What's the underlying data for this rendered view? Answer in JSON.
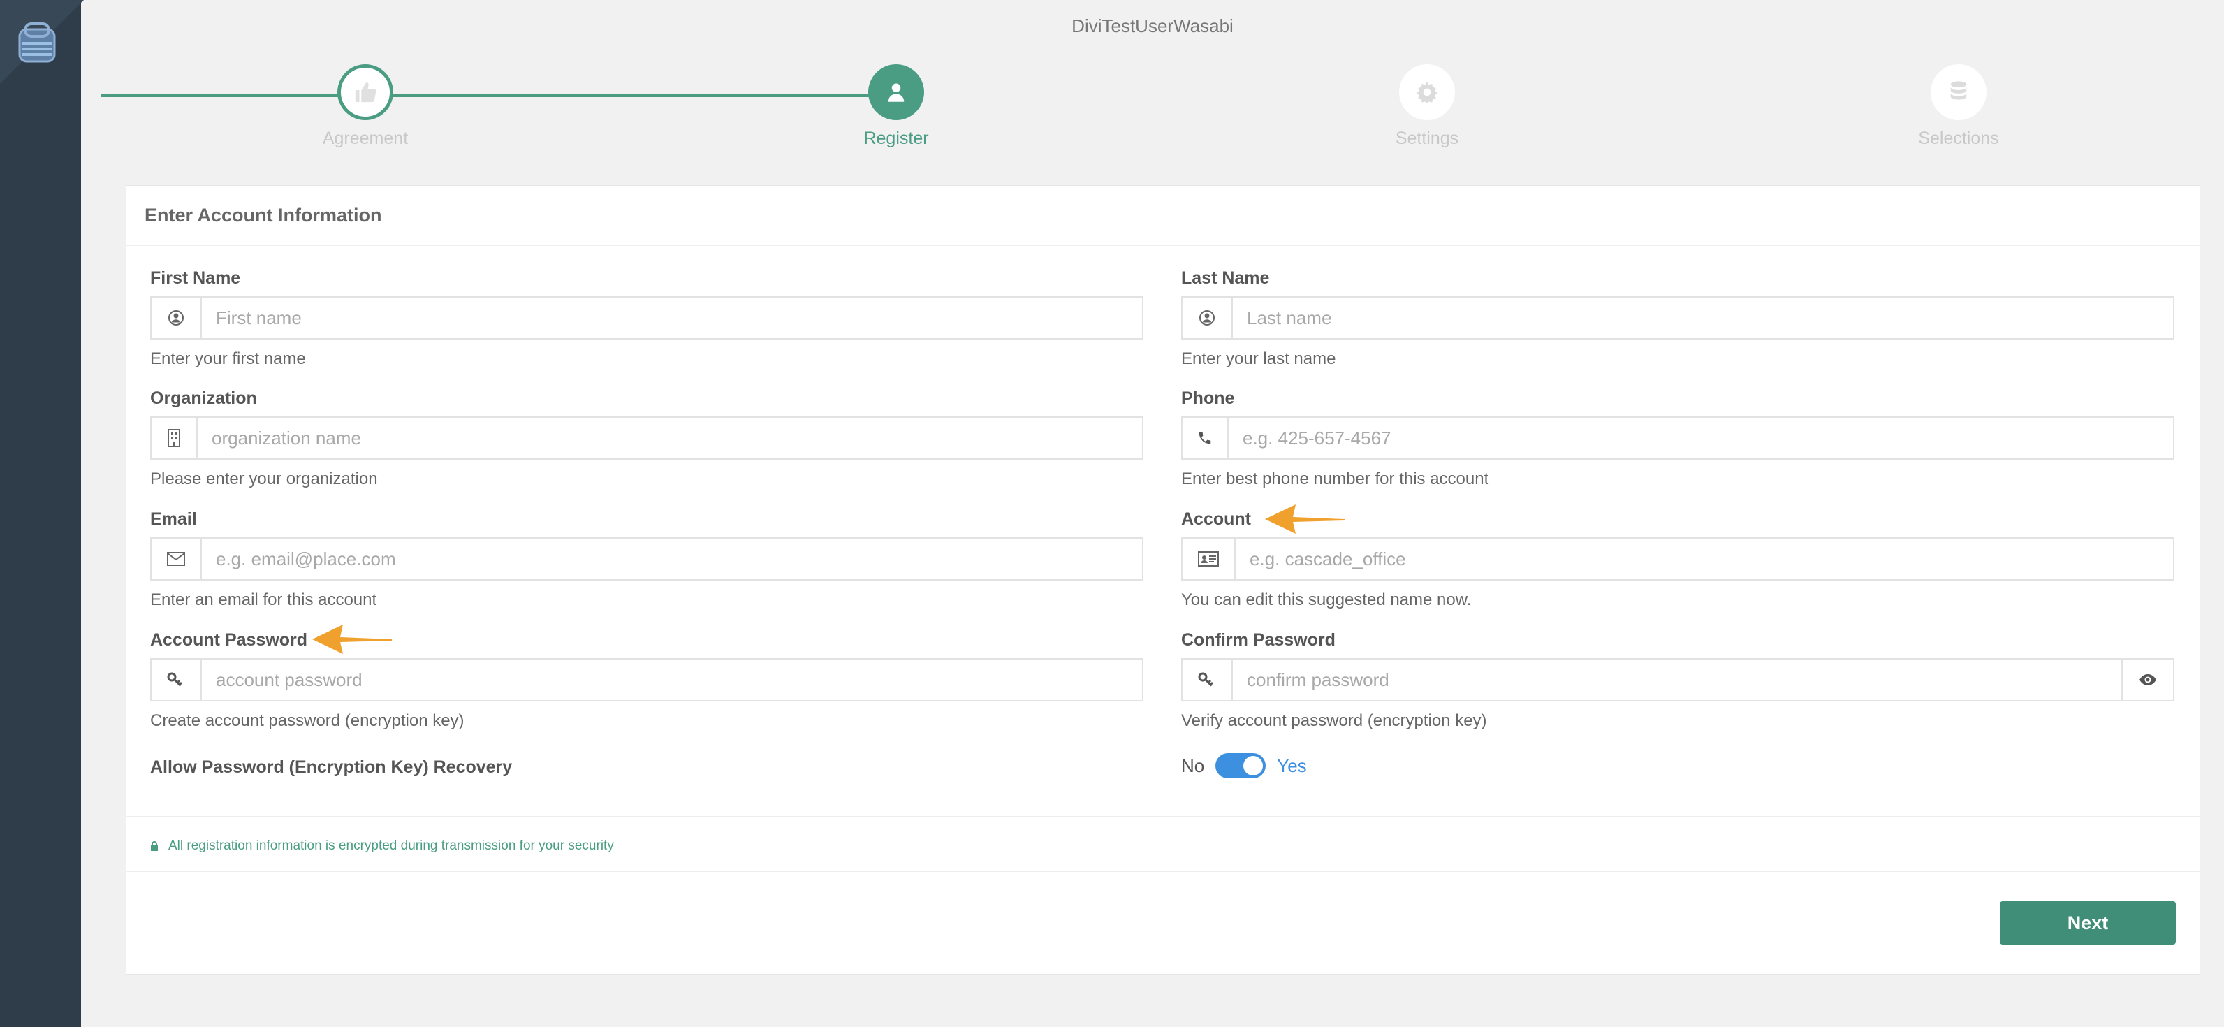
{
  "app": {
    "title": "DiviTestUserWasabi"
  },
  "stepper": {
    "steps": [
      {
        "label": "Agreement",
        "state": "done",
        "icon": "thumbs-up-icon"
      },
      {
        "label": "Register",
        "state": "active",
        "icon": "user-icon"
      },
      {
        "label": "Settings",
        "state": "pending",
        "icon": "gear-icon"
      },
      {
        "label": "Selections",
        "state": "pending",
        "icon": "database-icon"
      }
    ]
  },
  "card": {
    "title": "Enter Account Information"
  },
  "fields": {
    "first_name": {
      "label": "First Name",
      "placeholder": "First name",
      "help": "Enter your first name",
      "icon": "user-circle-icon"
    },
    "last_name": {
      "label": "Last Name",
      "placeholder": "Last name",
      "help": "Enter your last name",
      "icon": "user-circle-icon"
    },
    "organization": {
      "label": "Organization",
      "placeholder": "organization name",
      "help": "Please enter your organization",
      "icon": "building-icon"
    },
    "phone": {
      "label": "Phone",
      "placeholder": "e.g. 425-657-4567",
      "help": "Enter best phone number for this account",
      "icon": "phone-icon"
    },
    "email": {
      "label": "Email",
      "placeholder": "e.g. email@place.com",
      "help": "Enter an email for this account",
      "icon": "envelope-icon"
    },
    "account": {
      "label": "Account",
      "placeholder": "e.g. cascade_office",
      "help": "You can edit this suggested name now.",
      "icon": "id-card-icon"
    },
    "password": {
      "label": "Account Password",
      "placeholder": "account password",
      "help": "Create account password (encryption key)",
      "icon": "key-icon"
    },
    "confirm_password": {
      "label": "Confirm Password",
      "placeholder": "confirm password",
      "help": "Verify account password (encryption key)",
      "icon": "key-icon"
    }
  },
  "recovery": {
    "label": "Allow Password (Encryption Key) Recovery",
    "no": "No",
    "yes": "Yes",
    "enabled": true
  },
  "footer": {
    "secure_note": "All registration information is encrypted during transmission for your security",
    "next_label": "Next"
  },
  "colors": {
    "accent": "#4a9d83",
    "button": "#418e78",
    "toggle": "#3d8fe0",
    "arrow": "#f0a02c",
    "sidebar": "#2f3d4b"
  }
}
